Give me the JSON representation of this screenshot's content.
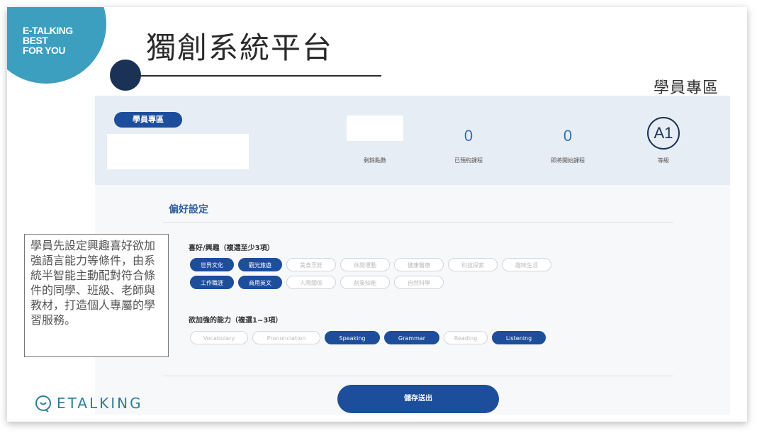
{
  "corner_text": "E-TALKING\nBEST\nFOR YOU",
  "title": "獨創系統平台",
  "area_label": "學員專區",
  "stats": {
    "badge": "學員專區",
    "points_label": "剩餘點數",
    "booked_value": "0",
    "booked_label": "已預約課程",
    "upcoming_value": "0",
    "upcoming_label": "即將開始課程",
    "level_value": "A1",
    "level_label": "等級"
  },
  "preferences": {
    "title": "偏好設定",
    "interests_label": "喜好/興趣（複選至少3項）",
    "interests": [
      {
        "label": "世界文化",
        "selected": true
      },
      {
        "label": "觀光旅遊",
        "selected": true
      },
      {
        "label": "美食烹飪",
        "selected": false
      },
      {
        "label": "休閒運動",
        "selected": false
      },
      {
        "label": "健康醫療",
        "selected": false
      },
      {
        "label": "科技探索",
        "selected": false
      },
      {
        "label": "趣味生活",
        "selected": false
      },
      {
        "label": "工作職涯",
        "selected": true
      },
      {
        "label": "商用英文",
        "selected": true
      },
      {
        "label": "人際關係",
        "selected": false
      },
      {
        "label": "創業知能",
        "selected": false
      },
      {
        "label": "自然科學",
        "selected": false
      }
    ],
    "skills_label": "欲加強的能力（複選1~3項）",
    "skills": [
      {
        "label": "Vocabulary",
        "selected": false
      },
      {
        "label": "Pronunciation",
        "selected": false
      },
      {
        "label": "Speaking",
        "selected": true
      },
      {
        "label": "Grammar",
        "selected": true
      },
      {
        "label": "Reading",
        "selected": false
      },
      {
        "label": "Listening",
        "selected": true
      }
    ],
    "save_label": "儲存送出"
  },
  "note": "學員先設定興趣喜好欲加強語言能力等條件，由系統半智能主動配對符合條件的同學、班級、老師與教材，打造個人專屬的學習服務。",
  "logo_text": "ETALKING",
  "colors": {
    "accent": "#1c4e9c",
    "teal": "#3d9fbf",
    "navy": "#1b3257"
  }
}
